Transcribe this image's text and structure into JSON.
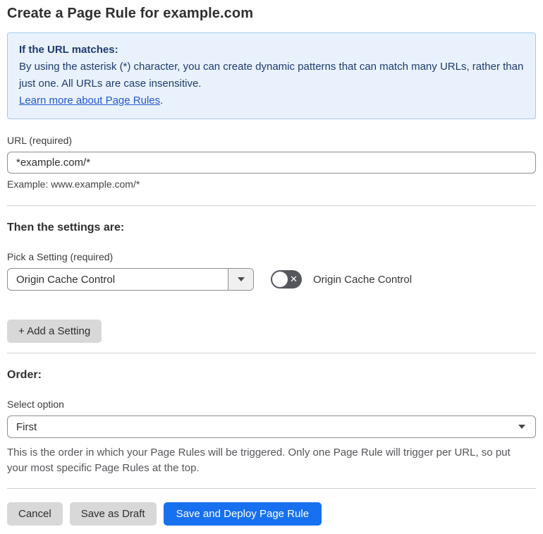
{
  "page": {
    "title": "Create a Page Rule for example.com"
  },
  "notice": {
    "heading": "If the URL matches:",
    "body": "By using the asterisk (*) character, you can create dynamic patterns that can match many URLs, rather than just one. All URLs are case insensitive.",
    "link_label": "Learn more about Page Rules",
    "link_suffix": "."
  },
  "url_section": {
    "label": "URL (required)",
    "value": "*example.com/*",
    "helper": "Example: www.example.com/*"
  },
  "settings_section": {
    "heading": "Then the settings are:",
    "picker_label": "Pick a Setting (required)",
    "picker_value": "Origin Cache Control",
    "toggle_state": "off",
    "toggle_icon": "✕",
    "toggle_label": "Origin Cache Control",
    "add_button_label": "+ Add a Setting"
  },
  "order_section": {
    "heading": "Order:",
    "label": "Select option",
    "value": "First",
    "helper": "This is the order in which your Page Rules will be triggered. Only one Page Rule will trigger per URL, so put your most specific Page Rules at the top."
  },
  "footer": {
    "cancel_label": "Cancel",
    "save_draft_label": "Save as Draft",
    "save_deploy_label": "Save and Deploy Page Rule"
  },
  "colors": {
    "accent_blue": "#1670f0",
    "notice_bg": "#e9f2fc",
    "notice_border": "#a6c8ec",
    "notice_text": "#1e3b6d",
    "link_blue": "#2458cc",
    "toggle_off_bg": "#54575c"
  }
}
